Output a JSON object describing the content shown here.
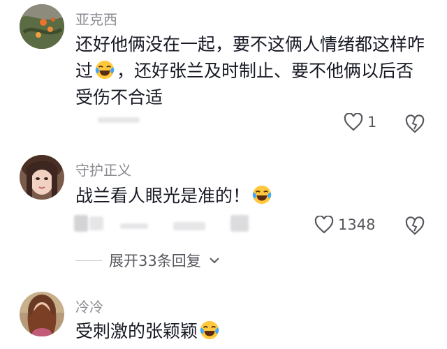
{
  "comments": [
    {
      "username": "亚克西",
      "text_parts": [
        "还好他俩没在一起，要不这俩人情绪都这样咋过",
        "，还好张兰及时制止、要不他俩以后否受伤不合适"
      ],
      "like_count": "1",
      "emoji": "laughing-crying-emoji"
    },
    {
      "username": "守护正义",
      "text_parts": [
        "战兰看人眼光是准的！",
        ""
      ],
      "like_count": "1348",
      "emoji": "laughing-crying-emoji"
    },
    {
      "username": "冷冷",
      "text_parts": [
        "受刺激的张颖颖",
        ""
      ],
      "emoji": "laughing-crying-emoji"
    }
  ],
  "replies": {
    "label": "展开33条回复"
  },
  "colors": {
    "text": "#161823",
    "meta": "#8a8b91",
    "icon": "#57585e",
    "emoji_face": "#ffc83d",
    "tear": "#3fa7ff"
  }
}
